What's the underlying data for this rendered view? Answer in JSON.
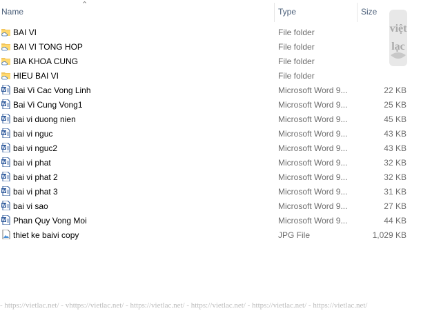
{
  "columns": {
    "name": "Name",
    "type": "Type",
    "size": "Size"
  },
  "files": [
    {
      "name": "BAI VI",
      "type": "File folder",
      "size": "",
      "icon": "folder-icon"
    },
    {
      "name": "BAI VI TONG HOP",
      "type": "File folder",
      "size": "",
      "icon": "folder-icon"
    },
    {
      "name": "BIA KHOA CUNG",
      "type": "File folder",
      "size": "",
      "icon": "folder-icon"
    },
    {
      "name": "HIEU BAI VI",
      "type": "File folder",
      "size": "",
      "icon": "folder-icon"
    },
    {
      "name": "Bai Vi Cac Vong Linh",
      "type": "Microsoft Word 9...",
      "size": "22 KB",
      "icon": "word-doc-icon"
    },
    {
      "name": "Bai Vi Cung Vong1",
      "type": "Microsoft Word 9...",
      "size": "25 KB",
      "icon": "word-doc-icon"
    },
    {
      "name": "bai vi duong nien",
      "type": "Microsoft Word 9...",
      "size": "45 KB",
      "icon": "word-doc-icon"
    },
    {
      "name": "bai vi nguc",
      "type": "Microsoft Word 9...",
      "size": "43 KB",
      "icon": "word-doc-icon"
    },
    {
      "name": "bai vi nguc2",
      "type": "Microsoft Word 9...",
      "size": "43 KB",
      "icon": "word-doc-icon"
    },
    {
      "name": "bai vi phat",
      "type": "Microsoft Word 9...",
      "size": "32 KB",
      "icon": "word-doc-icon"
    },
    {
      "name": "bai vi phat 2",
      "type": "Microsoft Word 9...",
      "size": "32 KB",
      "icon": "word-doc-icon"
    },
    {
      "name": "bai vi phat 3",
      "type": "Microsoft Word 9...",
      "size": "31 KB",
      "icon": "word-doc-icon"
    },
    {
      "name": "bai vi sao",
      "type": "Microsoft Word 9...",
      "size": "27 KB",
      "icon": "word-doc-icon"
    },
    {
      "name": "Phan Quy Vong Moi",
      "type": "Microsoft Word 9...",
      "size": "44 KB",
      "icon": "word-doc-icon"
    },
    {
      "name": "thiet ke baivi copy",
      "type": "JPG File",
      "size": "1,029 KB",
      "icon": "image-file-icon"
    }
  ],
  "watermark": "- https://vietlac.net/ - vhttps://vietlac.net/ - https://vietlac.net/ - https://vietlac.net/ - https://vietlac.net/ - https://vietlac.net/",
  "logo_text": "viet lac"
}
